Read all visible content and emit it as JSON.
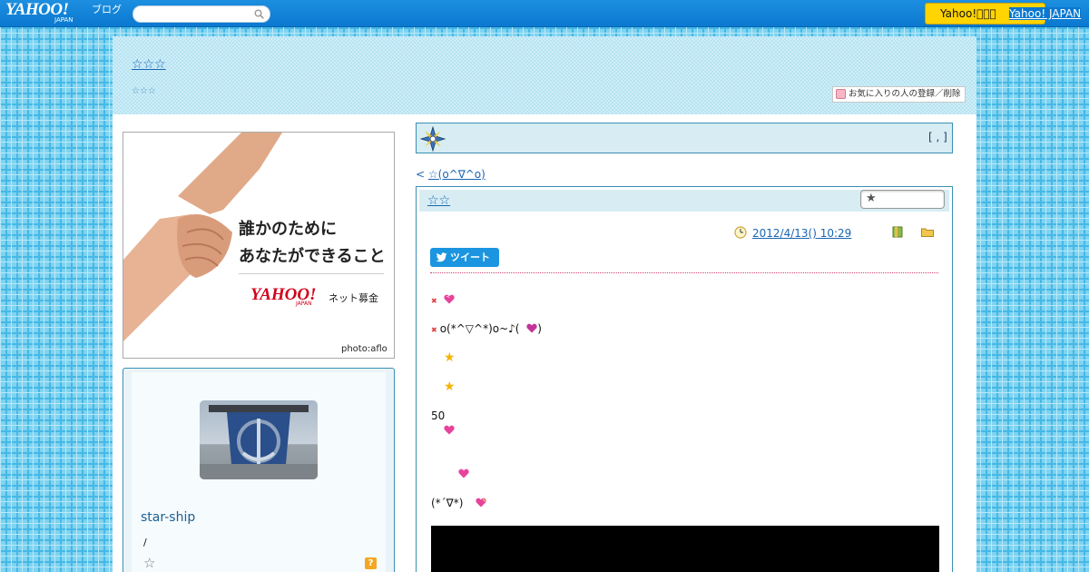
{
  "topbar": {
    "logo": "YAHOO!",
    "logo_sub": "JAPAN",
    "logo_blog": "ブログ",
    "search_placeholder": "",
    "yahoo_button": "Yahoo!􀀀􀀀􀀀",
    "yahoo_link": "Yahoo! JAPAN"
  },
  "header": {
    "blog_title": "☆☆☆",
    "blog_subtitle": "☆☆☆",
    "fav_button": "お気に入りの人の登録／削除"
  },
  "ad": {
    "headline_1": "誰かのために",
    "headline_2": "あなたができること",
    "logo": "YAHOO!",
    "logo_sub": "JAPAN",
    "tagline": "ネット募金",
    "credit": "photo:aflo"
  },
  "profile": {
    "name": "star-ship",
    "slash": "/",
    "star": "☆",
    "help": "?"
  },
  "category": {
    "brackets": "[ , ]"
  },
  "post": {
    "prev_arrow": "< ",
    "prev_link": "☆(o^∇^o)",
    "title": "☆☆",
    "date": "2012/4/13()  10:29",
    "tweet": "ツイート",
    "lines": [
      {
        "text": ""
      },
      {
        "text": "o(*^▽^*)o~♪(  ",
        "suffix": ")"
      },
      {
        "text": ""
      },
      {
        "text": ""
      },
      {
        "text": "50"
      },
      {
        "text": ""
      },
      {
        "text": ""
      },
      {
        "text": "(*´∇*)"
      }
    ]
  },
  "colors": {
    "topbar": "#0a78d0",
    "accent_link": "#1a66b3",
    "box_border": "#3a8fb5",
    "yahoo_button": "#ffd400",
    "tweet": "#1b95e0"
  }
}
